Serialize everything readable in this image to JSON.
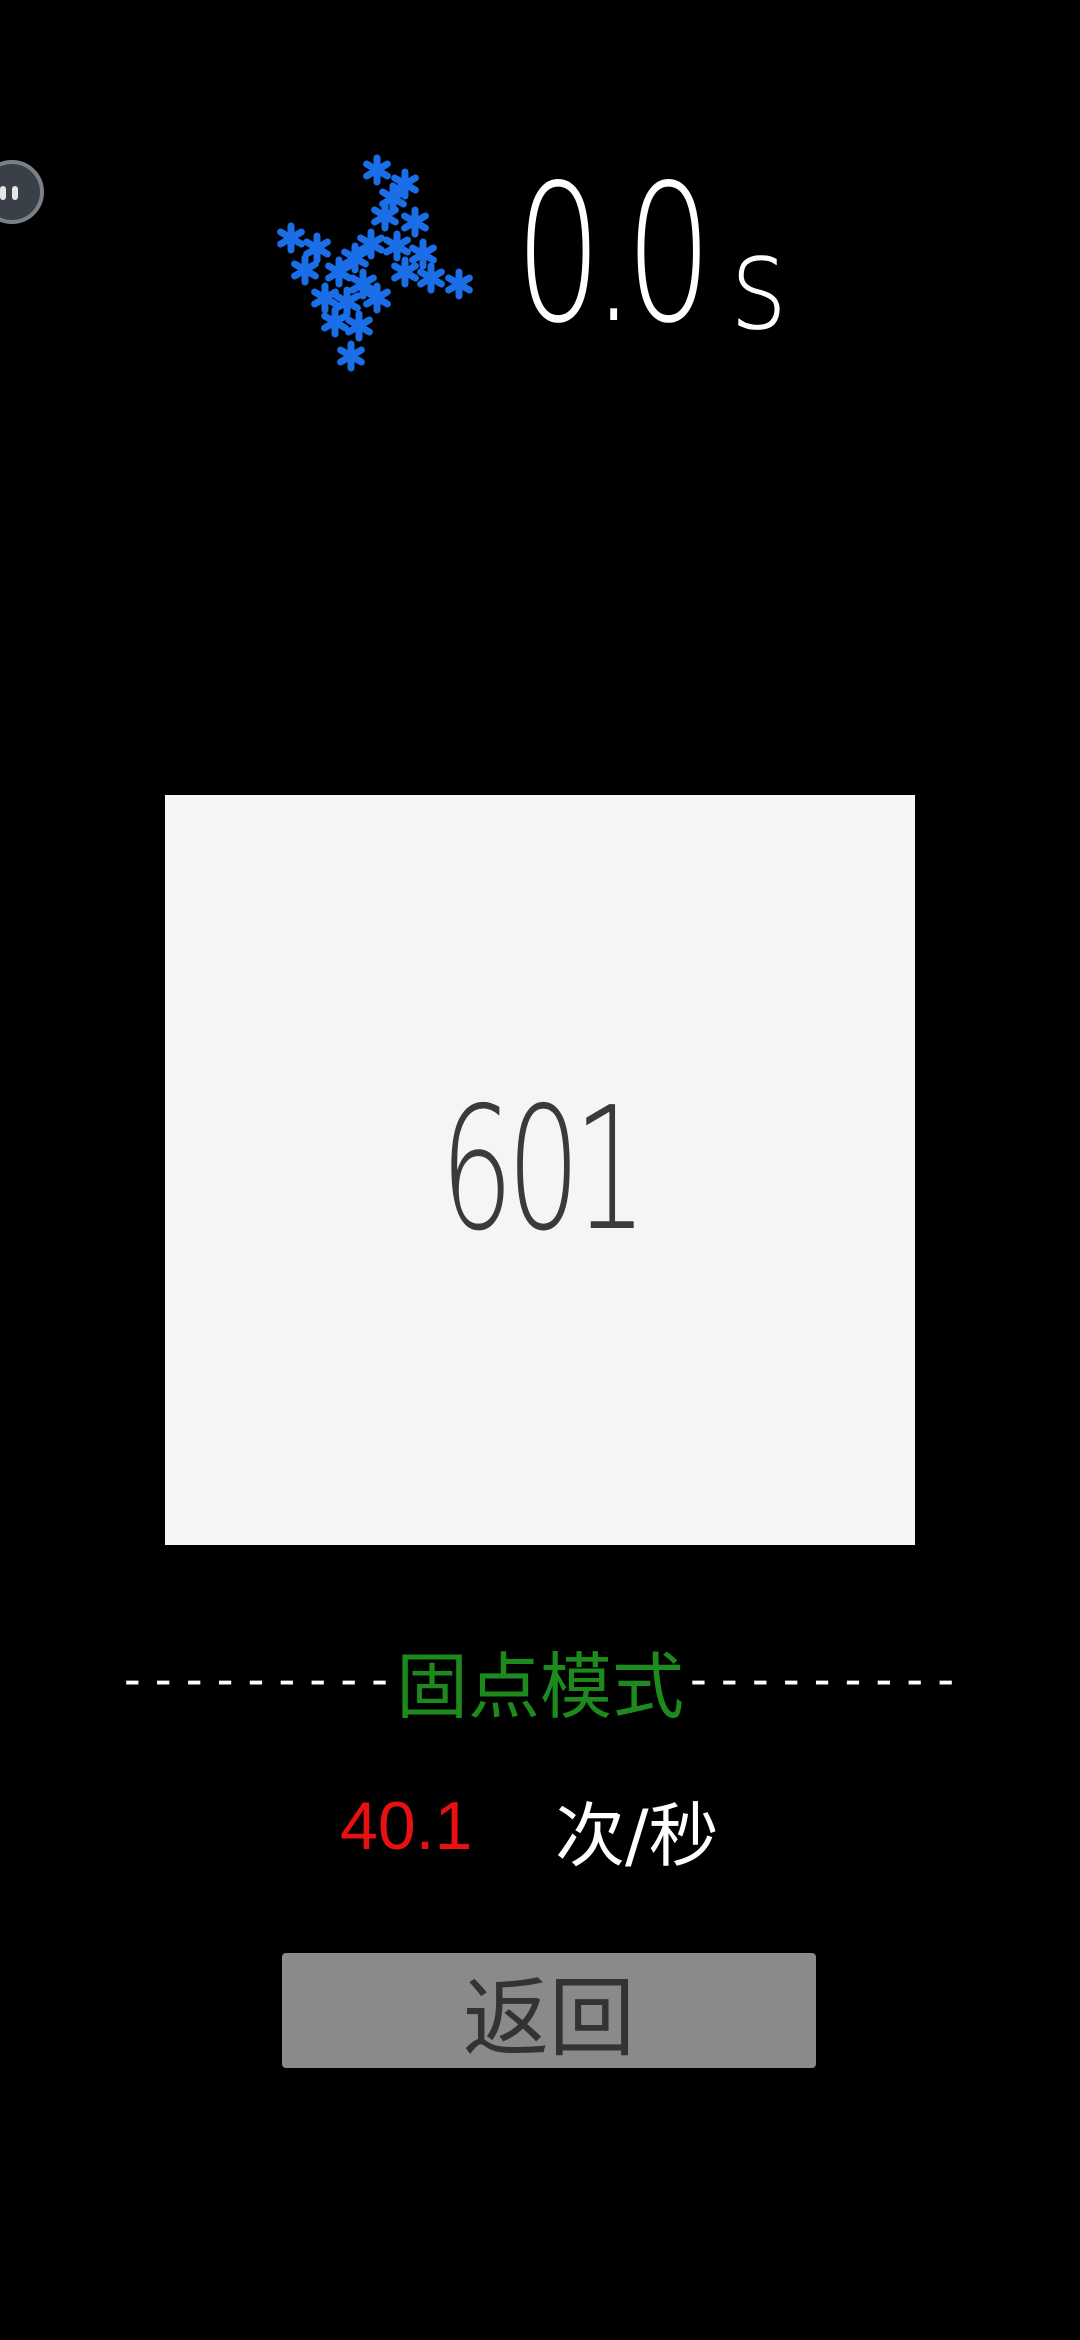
{
  "timer": {
    "value": "0.0",
    "unit": "s"
  },
  "header": {
    "icon": "blue-star-cluster-icon"
  },
  "tap_area": {
    "count": "601"
  },
  "mode": {
    "dashes_left": "---------",
    "label": "固点模式",
    "dashes_right": "---------"
  },
  "rate": {
    "value": "40.1",
    "unit": "次/秒"
  },
  "back_button": {
    "label": "返回"
  },
  "floating_ball": {
    "icon": "assistant-ball-icon"
  },
  "colors": {
    "background": "#000000",
    "icon_blue": "#1a6fe8",
    "mode_green": "#1c8a1c",
    "rate_red": "#e81010",
    "square": "#f5f5f5",
    "button": "#8a8a8a"
  }
}
